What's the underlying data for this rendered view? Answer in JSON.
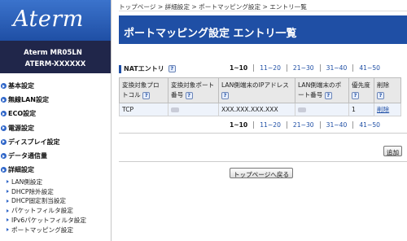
{
  "sidebar": {
    "logo": "Aterm",
    "model_line": "Aterm   MR05LN",
    "device_name": "ATERM-XXXXXX",
    "items": [
      {
        "label": "基本設定"
      },
      {
        "label": "無線LAN設定"
      },
      {
        "label": "ECO設定"
      },
      {
        "label": "電源設定"
      },
      {
        "label": "ディスプレイ設定"
      },
      {
        "label": "データ通信量"
      },
      {
        "label": "詳細設定"
      }
    ],
    "subitems": [
      {
        "label": "LAN側設定"
      },
      {
        "label": "DHCP除外設定"
      },
      {
        "label": "DHCP固定割当設定"
      },
      {
        "label": "パケットフィルタ設定"
      },
      {
        "label": "IPv6パケットフィルタ設定"
      },
      {
        "label": "ポートマッピング設定"
      }
    ]
  },
  "breadcrumb": "トップページ > 詳細設定 > ポートマッピング設定 > エントリ一覧",
  "title": "ポートマッピング設定 エントリ一覧",
  "section": {
    "label": "NATエントリ",
    "help": "?"
  },
  "pager": [
    "1~10",
    "11~20",
    "21~30",
    "31~40",
    "41~50"
  ],
  "table": {
    "headers": [
      {
        "label": "変換対象プロトコル",
        "help": "?"
      },
      {
        "label": "変換対象ポート番号",
        "help": "?"
      },
      {
        "label": "LAN側端末のIPアドレス",
        "help": "?"
      },
      {
        "label": "LAN側端末のポート番号",
        "help": "?"
      },
      {
        "label": "優先度",
        "help": "?"
      },
      {
        "label": "削除",
        "help": "?"
      }
    ],
    "rows": [
      {
        "protocol": "TCP",
        "ip": "XXX.XXX.XXX.XXX",
        "priority": "1",
        "delete": "削除"
      }
    ]
  },
  "buttons": {
    "add": "追加",
    "back": "トップページへ戻る"
  },
  "colors": {
    "brand": "#1f4fa5",
    "device_bg": "#20264a",
    "header_bg": "#e8e8e8"
  }
}
